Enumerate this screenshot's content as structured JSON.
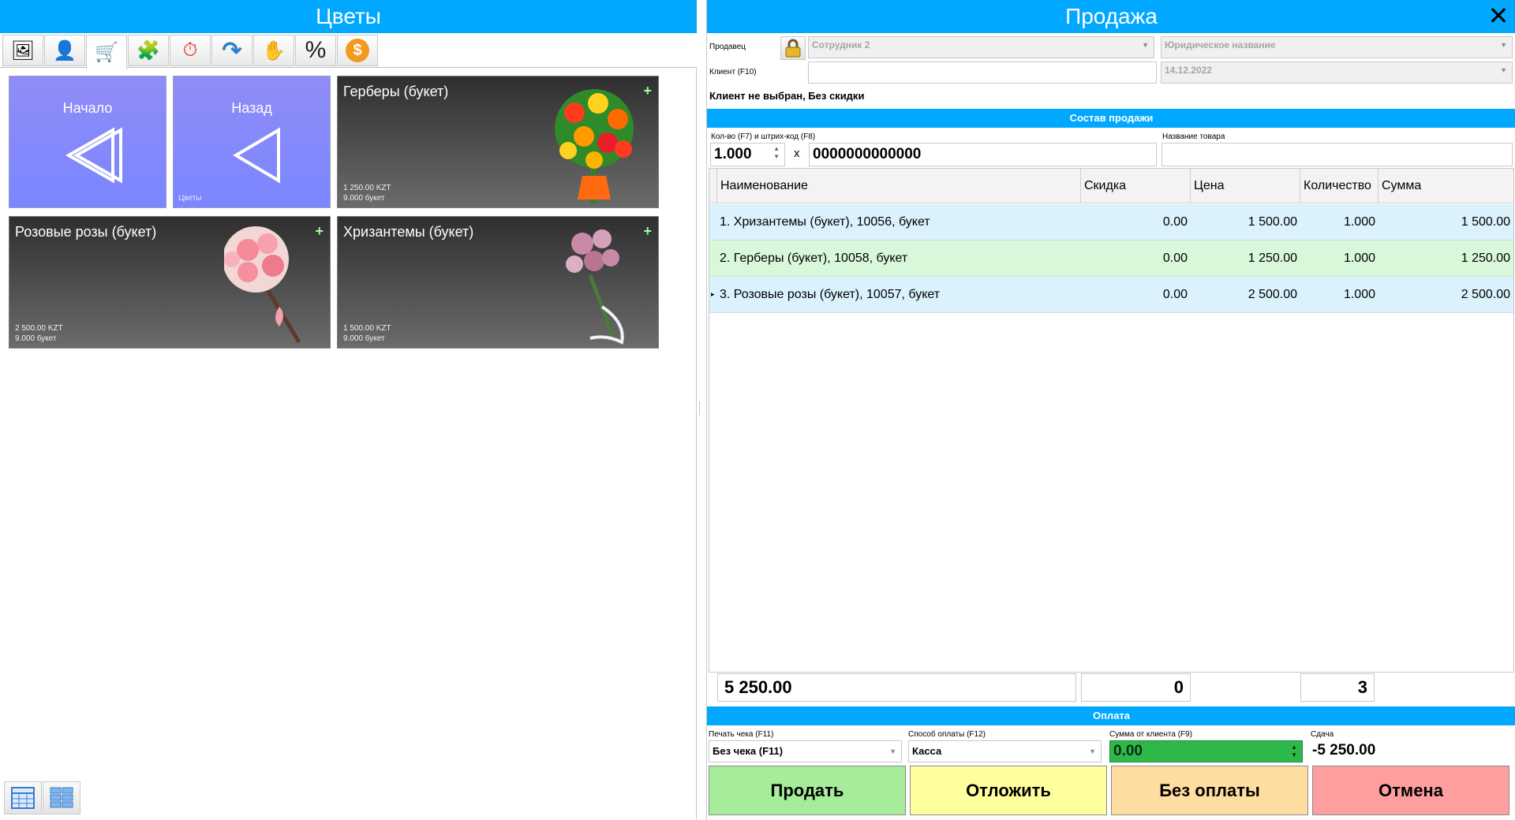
{
  "left": {
    "title": "Цветы",
    "toolbar": [
      {
        "icon": "picture-icon",
        "glyph": "🖼"
      },
      {
        "icon": "user-icon",
        "glyph": "👤"
      },
      {
        "icon": "cart-icon",
        "glyph": "🛒"
      },
      {
        "icon": "puzzle-icon",
        "glyph": "🧩"
      },
      {
        "icon": "clock-icon",
        "glyph": "⏱"
      },
      {
        "icon": "redo-arrow-icon",
        "glyph": "↷"
      },
      {
        "icon": "hand-icon",
        "glyph": "✋"
      },
      {
        "icon": "percent-icon",
        "glyph": "%"
      },
      {
        "icon": "dollar-coin-icon",
        "glyph": "$"
      }
    ],
    "tiles": {
      "start": {
        "label": "Начало"
      },
      "back": {
        "label": "Назад",
        "sub": "Цветы"
      },
      "gerbera": {
        "label": "Герберы (букет)",
        "price": "1 250.00 KZT",
        "stock": "9.000 букет"
      },
      "roses": {
        "label": "Розовые розы (букет)",
        "price": "2 500.00 KZT",
        "stock": "9.000 букет"
      },
      "chrysanthemum": {
        "label": "Хризантемы (букет)",
        "price": "1 500.00 KZT",
        "stock": "9.000 букет"
      }
    },
    "colors": {
      "accent": "#00a8ff",
      "nav_tile": "#8a8af8"
    }
  },
  "right": {
    "title": "Продажа",
    "seller_label": "Продавец",
    "seller_value": "Сотрудник 2",
    "legal_name": "Юридическое название",
    "client_label": "Клиент (F10)",
    "client_value": "",
    "date": "14.12.2022",
    "client_status": "Клиент не выбран, Без скидки",
    "section_sale": "Состав продажи",
    "qty_barcode_label": "Кол-во (F7) и штрих-код (F8)",
    "qty": "1.000",
    "times": "x",
    "barcode": "0000000000000",
    "product_name_label": "Название товара",
    "product_name_value": "",
    "columns": [
      "Наименование",
      "Скидка",
      "Цена",
      "Количество",
      "Сумма"
    ],
    "rows": [
      {
        "name": "1. Хризантемы (букет), 10056, букет",
        "discount": "0.00",
        "price": "1 500.00",
        "qty": "1.000",
        "sum": "1 500.00"
      },
      {
        "name": "2. Герберы (букет), 10058, букет",
        "discount": "0.00",
        "price": "1 250.00",
        "qty": "1.000",
        "sum": "1 250.00"
      },
      {
        "name": "3. Розовые розы (букет), 10057, букет",
        "discount": "0.00",
        "price": "2 500.00",
        "qty": "1.000",
        "sum": "2 500.00"
      }
    ],
    "total_sum": "5 250.00",
    "total_discount": "0",
    "total_qty": "3",
    "section_payment": "Оплата",
    "receipt_label": "Печать чека (F11)",
    "receipt_value": "Без чека (F11)",
    "method_label": "Способ оплаты (F12)",
    "method_value": "Касса",
    "client_sum_label": "Сумма от клиента (F9)",
    "client_sum_value": "0.00",
    "change_label": "Сдача",
    "change_value": "-5 250.00",
    "buttons": {
      "sell": "Продать",
      "postpone": "Отложить",
      "no_payment": "Без оплаты",
      "cancel": "Отмена"
    },
    "colors": {
      "sell": "#a7ec9b",
      "postpone": "#ffff9e",
      "no_payment": "#ffdca0",
      "cancel": "#ff9e9e",
      "client_sum": "#2db84a"
    }
  }
}
